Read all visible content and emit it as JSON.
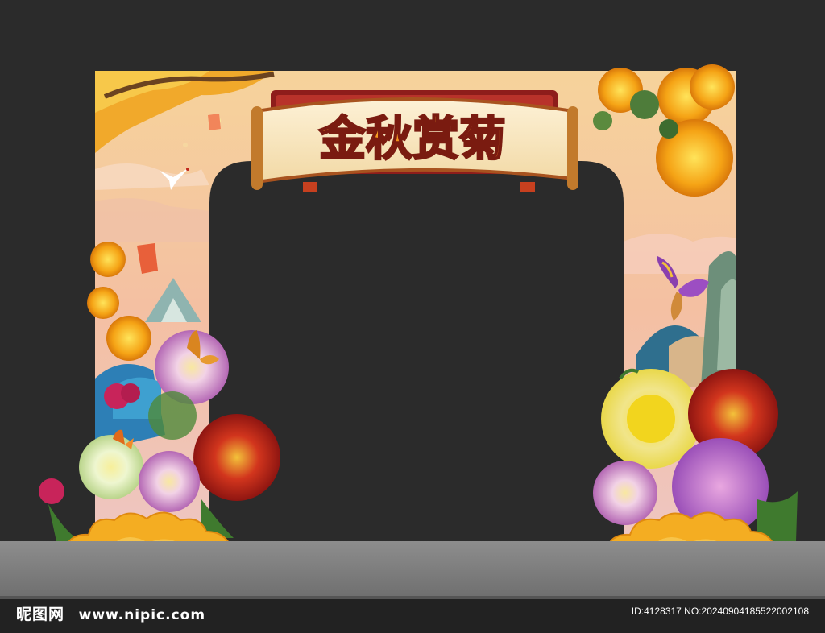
{
  "banner": {
    "title": "金秋赏菊"
  },
  "watermark": {
    "brand": "昵图网",
    "url": "www.nipic.com",
    "image_id": "ID:4128317 NO:20240904185522002108"
  },
  "colors": {
    "background": "#2b2b2b",
    "sky_top": "#f4c18e",
    "sky_bottom": "#f0b7a0",
    "gold": "#f3a91a",
    "banner_red": "#8e1d1b",
    "scroll_cream": "#f8e7c4"
  }
}
